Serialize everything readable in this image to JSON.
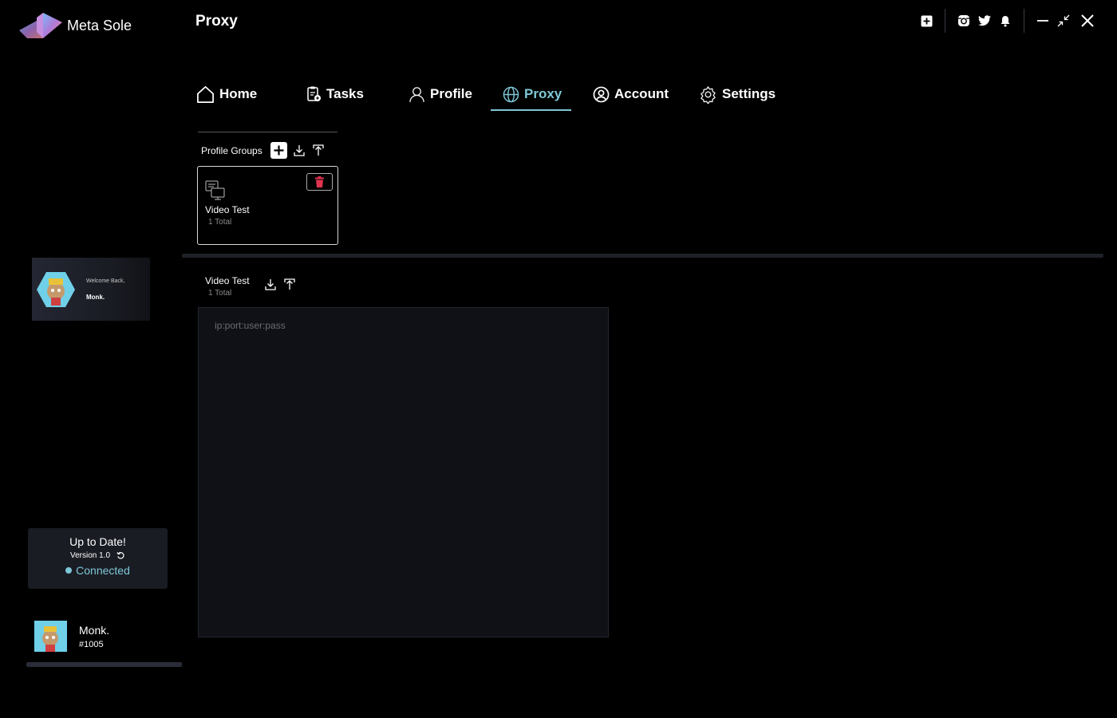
{
  "app": {
    "name": "Meta Sole",
    "page_title": "Proxy"
  },
  "nav": {
    "items": [
      {
        "label": "Home",
        "icon": "home-icon",
        "active": false
      },
      {
        "label": "Tasks",
        "icon": "tasks-icon",
        "active": false
      },
      {
        "label": "Profile",
        "icon": "user-icon",
        "active": false
      },
      {
        "label": "Proxy",
        "icon": "globe-icon",
        "active": true
      },
      {
        "label": "Account",
        "icon": "account-icon",
        "active": false
      },
      {
        "label": "Settings",
        "icon": "gear-icon",
        "active": false
      }
    ],
    "accent": "#7ec7d6"
  },
  "header_actions": [
    "add-square-icon",
    "instagram-icon",
    "twitter-icon",
    "bell-icon",
    "minimize-icon",
    "shrink-icon",
    "close-icon"
  ],
  "welcome": {
    "greeting": "Welcome Back,",
    "name": "Monk."
  },
  "update": {
    "title": "Up to Date!",
    "version": "Version 1.0",
    "status": "Connected",
    "status_color": "#7ec7d6"
  },
  "user": {
    "name": "Monk.",
    "tag": "#1005"
  },
  "profile_groups": {
    "label": "Profile Groups",
    "groups": [
      {
        "name": "Video Test",
        "total": "1 Total"
      }
    ]
  },
  "selected_group": {
    "name": "Video Test",
    "total": "1 Total"
  },
  "proxy_input": {
    "placeholder": "ip:port:user:pass",
    "value": ""
  },
  "colors": {
    "delete": "#e0344f",
    "panel": "#101117",
    "background": "#000000"
  }
}
